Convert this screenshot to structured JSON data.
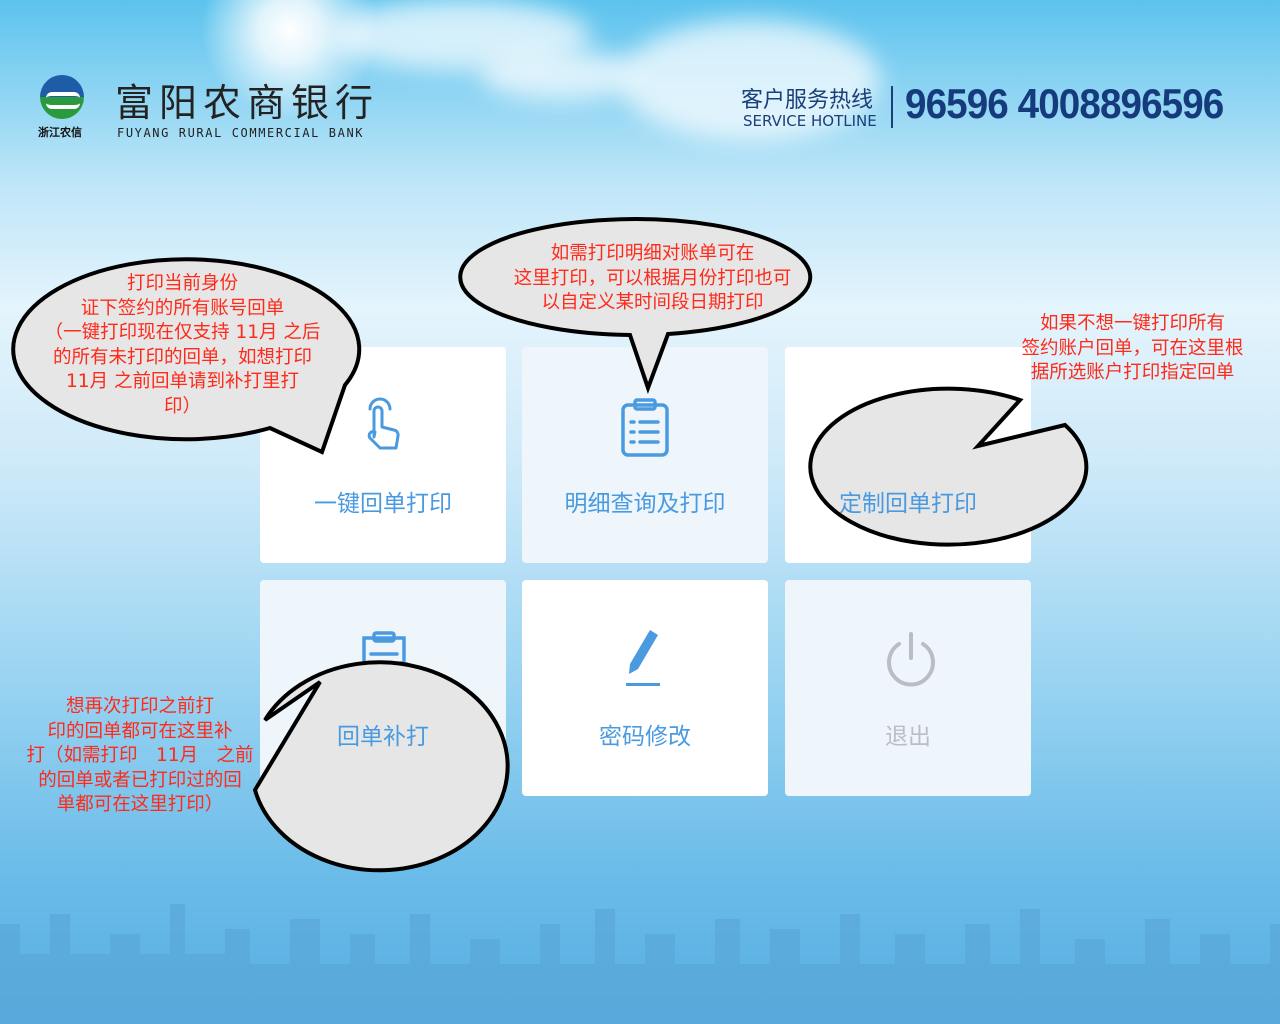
{
  "header": {
    "logo_sub": "浙江农信",
    "bank_name_cn": "富阳农商银行",
    "bank_name_en": "FUYANG RURAL COMMERCIAL BANK",
    "hotline_cn": "客户服务热线",
    "hotline_en": "SERVICE HOTLINE",
    "hotline_numbers": "96596 4008896596"
  },
  "menu": [
    {
      "label": "一键回单打印",
      "icon": "hand-pointer-icon"
    },
    {
      "label": "明细查询及打印",
      "icon": "clipboard-list-icon"
    },
    {
      "label": "定制回单打印",
      "icon": "edit-form-icon"
    },
    {
      "label": "回单补打",
      "icon": "reprint-icon"
    },
    {
      "label": "密码修改",
      "icon": "pen-icon"
    },
    {
      "label": "退出",
      "icon": "power-icon"
    }
  ],
  "tips": {
    "one_click": [
      "打印当前身份",
      "证下签约的所有账号回单",
      "（一键打印现在仅支持 11月 之后",
      "的所有未打印的回单，如想打印",
      "11月 之前回单请到补打里打",
      "印）"
    ],
    "detail": [
      "如需打印明细对账单可在",
      "这里打印，可以根据月份打印也可",
      "以自定义某时间段日期打印"
    ],
    "custom": [
      "如果不想一键打印所有",
      "签约账户回单，可在这里根",
      "据所选账户打印指定回单"
    ],
    "reprint": [
      "想再次打印之前打",
      "印的回单都可在这里补",
      "打（如需打印　11月　之前",
      "的回单或者已打印过的回",
      "单都可在这里打印）"
    ]
  },
  "colors": {
    "accent": "#4a9ae0",
    "tip_text": "#ff2a1a",
    "hotline": "#163b7c"
  }
}
